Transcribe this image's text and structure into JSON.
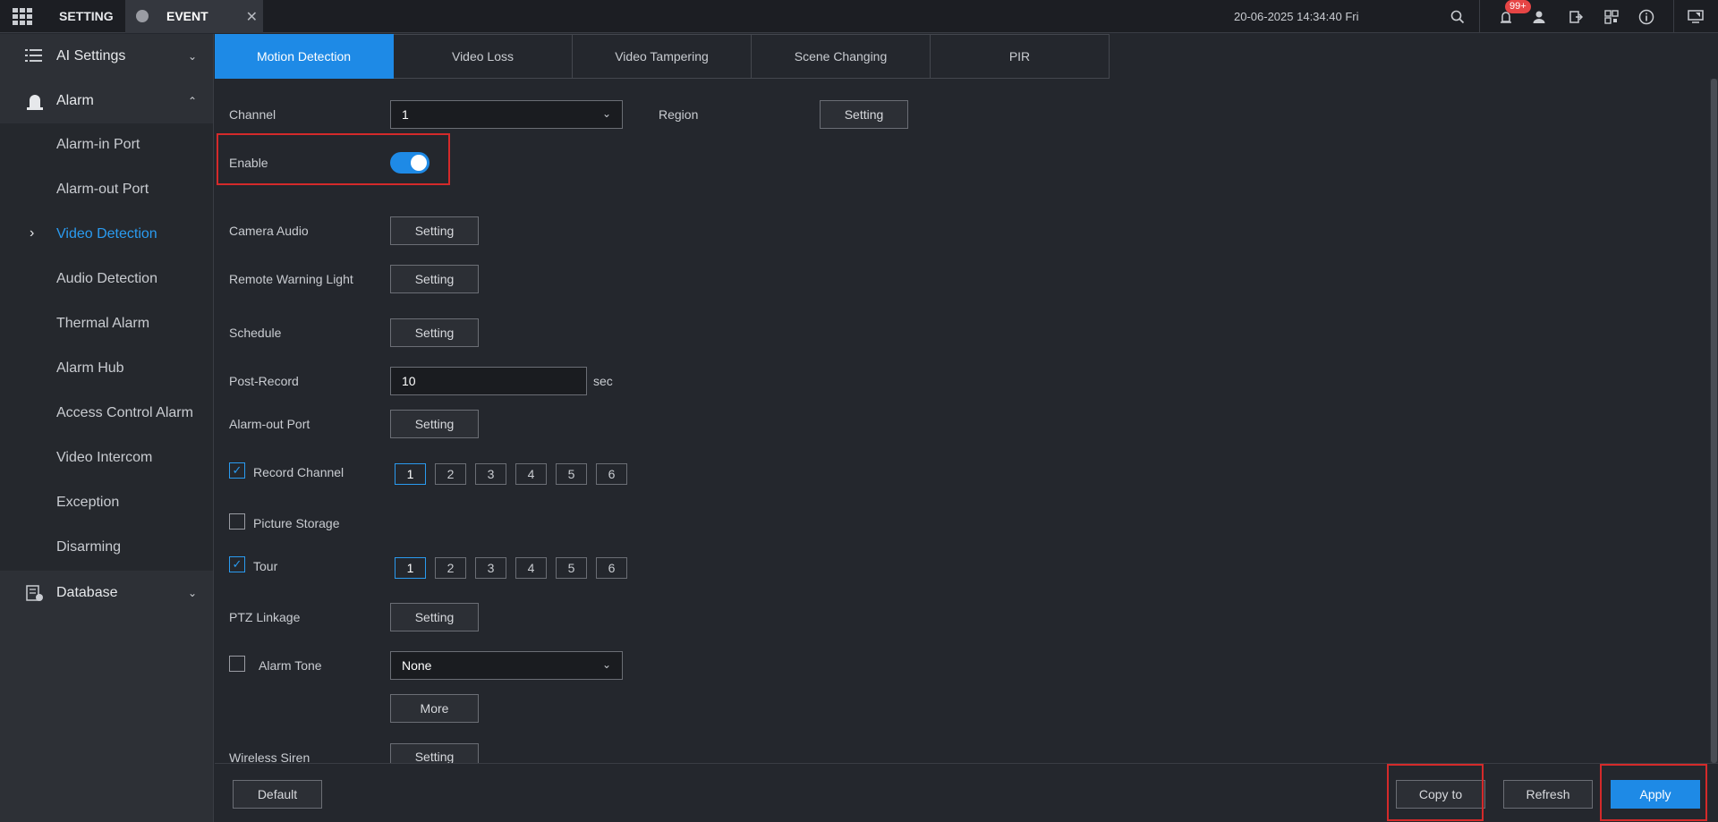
{
  "topbar": {
    "setting_label": "SETTING",
    "event_label": "EVENT",
    "close_glyph": "✕",
    "datetime": "20-06-2025 14:34:40 Fri",
    "badge": "99+"
  },
  "sidebar": {
    "ai_settings": "AI Settings",
    "alarm": "Alarm",
    "database": "Database",
    "items": [
      {
        "label": "Alarm-in Port"
      },
      {
        "label": "Alarm-out Port"
      },
      {
        "label": "Video Detection",
        "active": true
      },
      {
        "label": "Audio Detection"
      },
      {
        "label": "Thermal Alarm"
      },
      {
        "label": "Alarm Hub"
      },
      {
        "label": "Access Control Alarm"
      },
      {
        "label": "Video Intercom"
      },
      {
        "label": "Exception"
      },
      {
        "label": "Disarming"
      }
    ]
  },
  "tabs": [
    "Motion Detection",
    "Video Loss",
    "Video Tampering",
    "Scene Changing",
    "PIR"
  ],
  "form": {
    "channel_label": "Channel",
    "channel_value": "1",
    "region_label": "Region",
    "enable_label": "Enable",
    "enable_on": true,
    "camera_audio_label": "Camera Audio",
    "remote_warning_light_label": "Remote Warning Light",
    "schedule_label": "Schedule",
    "post_record_label": "Post-Record",
    "post_record_value": "10",
    "post_record_unit": "sec",
    "alarm_out_port_label": "Alarm-out Port",
    "record_channel_label": "Record Channel",
    "picture_storage_label": "Picture Storage",
    "tour_label": "Tour",
    "ptz_linkage_label": "PTZ Linkage",
    "alarm_tone_label": "Alarm Tone",
    "alarm_tone_value": "None",
    "wireless_siren_label": "Wireless Siren",
    "setting_button": "Setting",
    "more_button": "More",
    "channel_numbers": [
      "1",
      "2",
      "3",
      "4",
      "5",
      "6"
    ]
  },
  "footer": {
    "default": "Default",
    "copy_to": "Copy to",
    "refresh": "Refresh",
    "apply": "Apply"
  },
  "colors": {
    "accent": "#1e8ae6",
    "highlight": "#d42a2a",
    "active_text": "#2a9bf0"
  }
}
